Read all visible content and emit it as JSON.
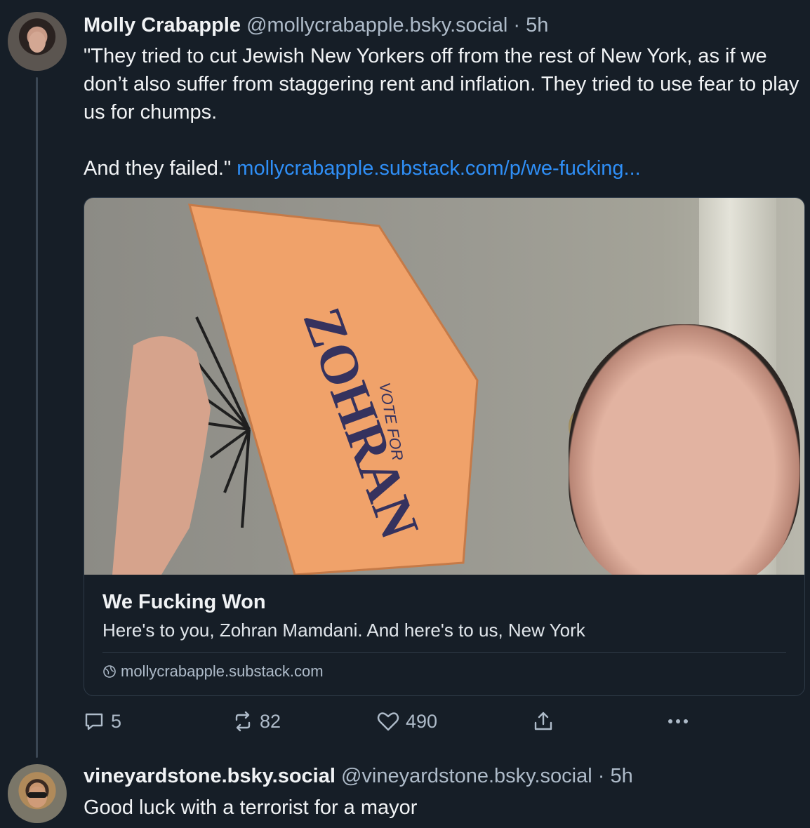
{
  "post1": {
    "display_name": "Molly Crabapple",
    "handle": "@mollycrabapple.bsky.social",
    "separator": "·",
    "time": "5h",
    "text_paragraph_1": "\"They tried to cut Jewish New Yorkers off from the rest of New York, as if we don’t also suffer from staggering rent and inflation. They tried to use fear to play us for chumps.",
    "text_paragraph_2": "And they failed.\"",
    "link_text": "mollycrabapple.substack.com/p/we-fucking...",
    "card": {
      "title": "We Fucking Won",
      "description": "Here's to you, Zohran Mamdani. And here's to us, New York",
      "domain": "mollycrabapple.substack.com",
      "image_fan_text": "ZOHRAN",
      "image_fan_subtext": "VOTE FOR"
    },
    "actions": {
      "reply_count": "5",
      "repost_count": "82",
      "like_count": "490"
    }
  },
  "post2": {
    "display_name": "vineyardstone.bsky.social",
    "handle": "@vineyardstone.bsky.social",
    "separator": "·",
    "time": "5h",
    "text": "Good luck with a terrorist for a mayor"
  },
  "colors": {
    "background": "#161e27",
    "text_primary": "#f1f3f5",
    "text_secondary": "#aebbc9",
    "link": "#2f8ff7",
    "border": "#2e3a47"
  },
  "icons": [
    "reply-icon",
    "repost-icon",
    "like-icon",
    "share-icon",
    "more-icon",
    "globe-icon"
  ]
}
